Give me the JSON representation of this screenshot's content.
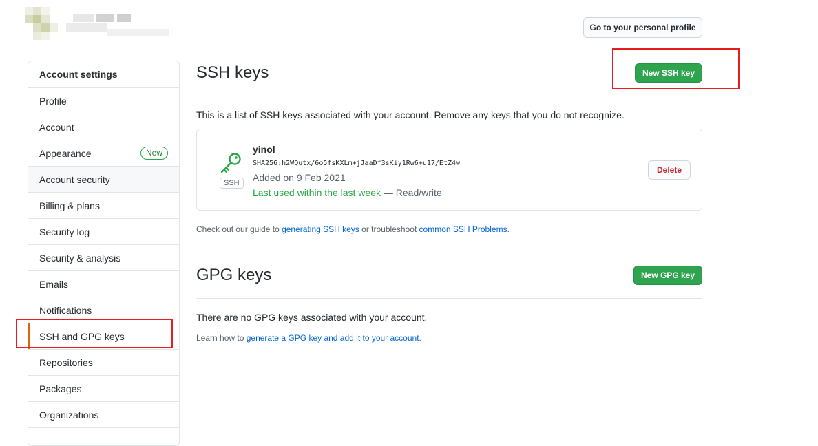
{
  "header": {
    "profile_button": "Go to your personal profile"
  },
  "sidebar": {
    "title": "Account settings",
    "items": [
      {
        "label": "Profile"
      },
      {
        "label": "Account"
      },
      {
        "label": "Appearance",
        "badge": "New"
      },
      {
        "label": "Account security"
      },
      {
        "label": "Billing & plans"
      },
      {
        "label": "Security log"
      },
      {
        "label": "Security & analysis"
      },
      {
        "label": "Emails"
      },
      {
        "label": "Notifications"
      },
      {
        "label": "SSH and GPG keys"
      },
      {
        "label": "Repositories"
      },
      {
        "label": "Packages"
      },
      {
        "label": "Organizations"
      }
    ]
  },
  "ssh": {
    "title": "SSH keys",
    "new_button": "New SSH key",
    "description": "This is a list of SSH keys associated with your account. Remove any keys that you do not recognize.",
    "key": {
      "name": "yinol",
      "fingerprint": "SHA256:h2WQutx/6o5fsKXLm+jJaaDf3sKiy1Rw6+u17/EtZ4w",
      "added": "Added on 9 Feb 2021",
      "last_used": "Last used within the last week",
      "access": " — Read/write",
      "type_label": "SSH",
      "delete_button": "Delete"
    },
    "help_prefix": "Check out our guide to ",
    "help_link1": "generating SSH keys",
    "help_middle": " or troubleshoot ",
    "help_link2": "common SSH Problems",
    "help_suffix": "."
  },
  "gpg": {
    "title": "GPG keys",
    "new_button": "New GPG key",
    "empty_text": "There are no GPG keys associated with your account.",
    "help_prefix": "Learn how to ",
    "help_link": "generate a GPG key and add it to your account",
    "help_suffix": "."
  },
  "colors": {
    "primary_green": "#2ea44f",
    "link_blue": "#0366d6",
    "danger_red": "#cb2431",
    "annotation_red": "#e81c1c",
    "selected_marker": "#e36209"
  },
  "icons": {
    "key": "key-icon"
  }
}
